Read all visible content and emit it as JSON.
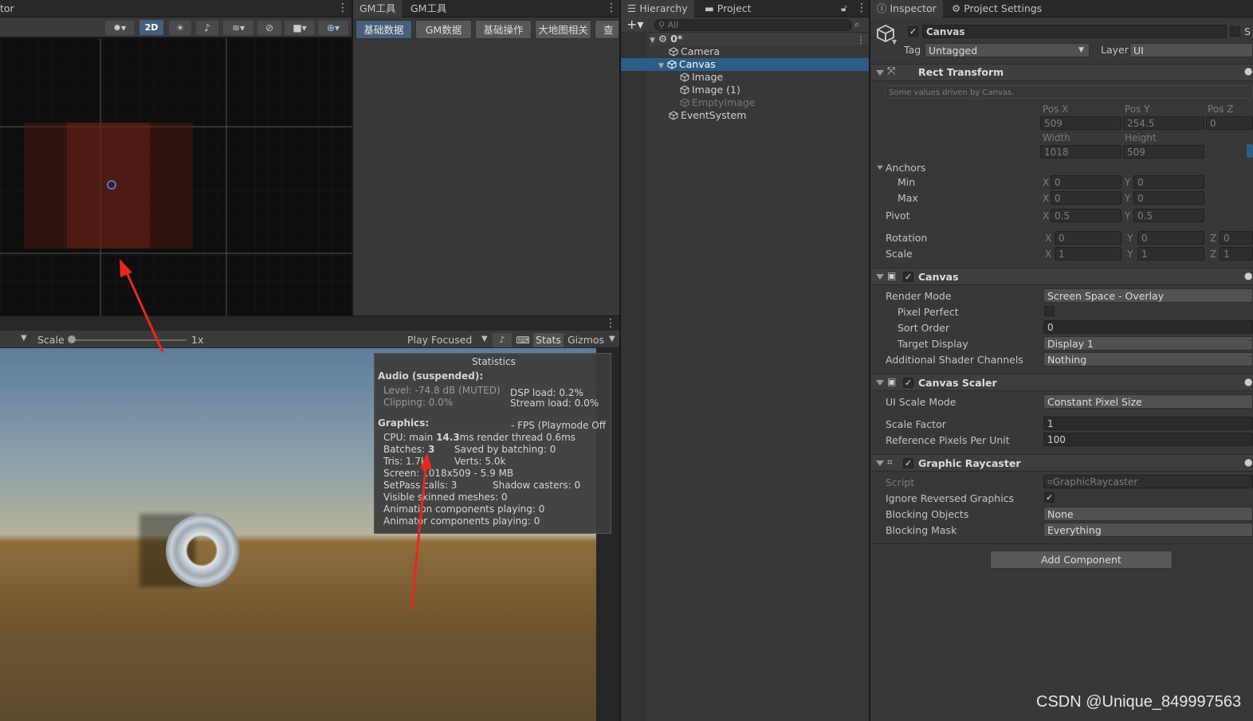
{
  "scene_view": {
    "tab_title": "tor",
    "toolbar_2d": "2D"
  },
  "gm_tools": {
    "tabs": [
      "GM工具",
      "GM工具"
    ],
    "buttons": [
      "基础数据",
      "GM数据",
      "基础操作",
      "大地图相关",
      "查看"
    ]
  },
  "game_view": {
    "scale_label": "Scale",
    "scale_value": "1x",
    "play_mode": "Play Focused",
    "stats_label": "Stats",
    "gizmos_label": "Gizmos"
  },
  "statistics": {
    "title": "Statistics",
    "audio_header": "Audio (suspended):",
    "level": "Level: -74.8 dB (MUTED)",
    "clipping": "Clipping: 0.0%",
    "dsp_load": "DSP load: 0.2%",
    "stream_load": "Stream load: 0.0%",
    "graphics_header": "Graphics:",
    "fps": "- FPS (Playmode Off",
    "cpu": "CPU: main ",
    "cpu_main": "14.3",
    "cpu_suffix": "ms  render thread 0.6ms",
    "batches": "Batches: ",
    "batches_value": "3",
    "saved_by_batching": "Saved by batching: 0",
    "tris": "Tris: 1.7k",
    "verts": "Verts: 5.0k",
    "screen": "Screen: 1018x509 - 5.9 MB",
    "setpass": "SetPass calls: 3",
    "shadow_casters": "Shadow casters: 0",
    "skinned": "Visible skinned meshes: 0",
    "anim_playing": "Animation components playing: 0",
    "animator_playing": "Animator components playing: 0"
  },
  "hierarchy": {
    "tab": "Hierarchy",
    "project_tab": "Project",
    "search_placeholder": "All",
    "scene": "0*",
    "items": [
      "Camera",
      "Canvas",
      "Image",
      "Image (1)",
      "EmptyImage",
      "EventSystem"
    ]
  },
  "inspector": {
    "tab": "Inspector",
    "settings_tab": "Project Settings",
    "object_name": "Canvas",
    "static_label": "S",
    "tag_label": "Tag",
    "tag_value": "Untagged",
    "layer_label": "Layer",
    "layer_value": "UI",
    "rect_transform": {
      "title": "Rect Transform",
      "note": "Some values driven by Canvas.",
      "pos_x_label": "Pos X",
      "pos_y_label": "Pos Y",
      "pos_z_label": "Pos Z",
      "pos_x": "509",
      "pos_y": "254.5",
      "pos_z": "0",
      "width_label": "Width",
      "height_label": "Height",
      "width": "1018",
      "height": "509",
      "anchors_label": "Anchors",
      "min_label": "Min",
      "max_label": "Max",
      "pivot_label": "Pivot",
      "rotation_label": "Rotation",
      "scale_label": "Scale",
      "min_x": "0",
      "min_y": "0",
      "max_x": "0",
      "max_y": "0",
      "pivot_x": "0.5",
      "pivot_y": "0.5",
      "rot_x": "0",
      "rot_y": "0",
      "rot_z": "0",
      "scale_x": "1",
      "scale_y": "1",
      "scale_z": "1",
      "x": "X",
      "y": "Y",
      "z": "Z"
    },
    "canvas": {
      "title": "Canvas",
      "render_mode_label": "Render Mode",
      "render_mode": "Screen Space - Overlay",
      "pixel_perfect_label": "Pixel Perfect",
      "sort_order_label": "Sort Order",
      "sort_order": "0",
      "target_display_label": "Target Display",
      "target_display": "Display 1",
      "shader_channels_label": "Additional Shader Channels",
      "shader_channels": "Nothing"
    },
    "canvas_scaler": {
      "title": "Canvas Scaler",
      "ui_scale_mode_label": "UI Scale Mode",
      "ui_scale_mode": "Constant Pixel Size",
      "scale_factor_label": "Scale Factor",
      "scale_factor": "1",
      "ref_ppu_label": "Reference Pixels Per Unit",
      "ref_ppu": "100"
    },
    "graphic_raycaster": {
      "title": "Graphic Raycaster",
      "script_label": "Script",
      "script": "GraphicRaycaster",
      "ignore_reversed_label": "Ignore Reversed Graphics",
      "blocking_objects_label": "Blocking Objects",
      "blocking_objects": "None",
      "blocking_mask_label": "Blocking Mask",
      "blocking_mask": "Everything"
    },
    "add_component": "Add Component"
  },
  "watermark": "CSDN @Unique_849997563",
  "colors": {
    "selection": "#2c5d87",
    "arrow": "#e8281c",
    "button_selected": "#46607c"
  }
}
